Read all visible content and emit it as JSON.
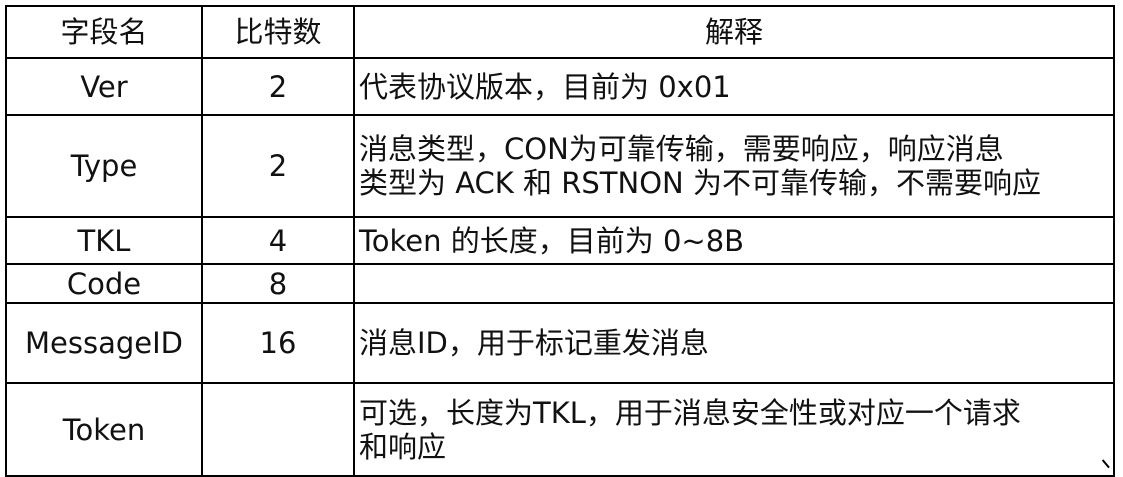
{
  "table": {
    "headers": [
      "字段名",
      "比特数",
      "解释"
    ],
    "rows": [
      {
        "field": "Ver",
        "bits": "2",
        "desc": [
          "代表协议版本，目前为 0x01"
        ]
      },
      {
        "field": "Type",
        "bits": "2",
        "desc": [
          "消息类型，CON为可靠传输，需要响应，响应消息",
          "类型为 ACK 和 RSTNON 为不可靠传输，不需要响应"
        ]
      },
      {
        "field": "TKL",
        "bits": "4",
        "desc": [
          "Token 的长度，目前为 0~8B"
        ]
      },
      {
        "field": "Code",
        "bits": "8",
        "desc": [
          ""
        ]
      },
      {
        "field": "MessageID",
        "bits": "16",
        "desc": [
          "消息ID，用于标记重发消息"
        ]
      },
      {
        "field": "Token",
        "bits": "",
        "desc": [
          "可选，长度为TKL，用于消息安全性或对应一个请求",
          "和响应"
        ]
      }
    ]
  }
}
